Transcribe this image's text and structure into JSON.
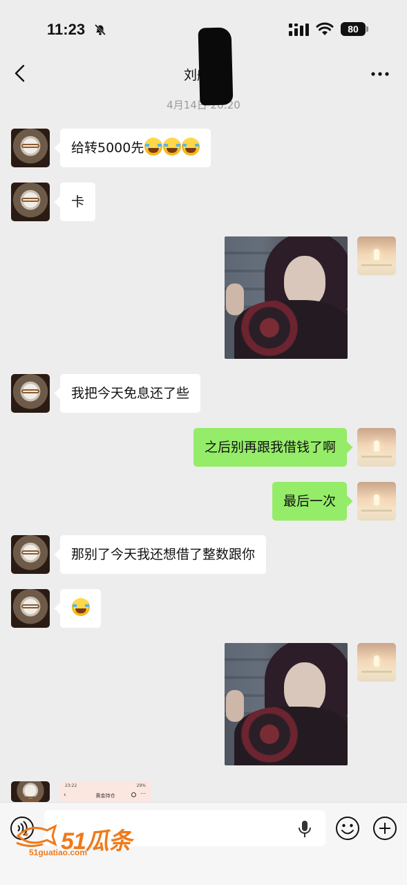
{
  "status": {
    "time": "11:23",
    "battery": "80",
    "muted_icon": "bell-slash-icon",
    "signal_icon": "cellular-signal-icon",
    "wifi_icon": "wifi-icon"
  },
  "nav": {
    "title": "刘航汝",
    "back_icon": "chevron-left-icon",
    "more_icon": "more-dots-icon"
  },
  "timestamp": "4月14日 20:20",
  "messages": [
    {
      "side": "left",
      "type": "text",
      "text": "给转5000先",
      "emoji_count": 3
    },
    {
      "side": "left",
      "type": "text",
      "text": "卡"
    },
    {
      "side": "right",
      "type": "image",
      "desc_icon": "sticker-image"
    },
    {
      "side": "left",
      "type": "text",
      "text": "我把今天免息还了些"
    },
    {
      "side": "right",
      "type": "text",
      "text": "之后别再跟我借钱了啊"
    },
    {
      "side": "right",
      "type": "text",
      "text": "最后一次"
    },
    {
      "side": "left",
      "type": "text",
      "text": "那别了今天我还想借了整数跟你"
    },
    {
      "side": "left",
      "type": "emoji",
      "emoji_count": 1
    },
    {
      "side": "right",
      "type": "image",
      "desc_icon": "sticker-image"
    },
    {
      "side": "left",
      "type": "screenshot-preview"
    }
  ],
  "preview": {
    "time": "23:22",
    "status": "29%",
    "title": "黄金持仓",
    "back": "‹",
    "more": "⋯"
  },
  "input_bar": {
    "voice_icon": "voice-icon",
    "mic_icon": "microphone-icon",
    "emoji_icon": "emoji-face-icon",
    "plus_icon": "plus-circle-icon"
  },
  "watermark": {
    "brand": "51瓜条",
    "url": "51guatiao.com"
  },
  "colors": {
    "background": "#ededed",
    "bubble_self": "#95ec69",
    "bubble_other": "#ffffff",
    "watermark": "#f07a1a"
  }
}
